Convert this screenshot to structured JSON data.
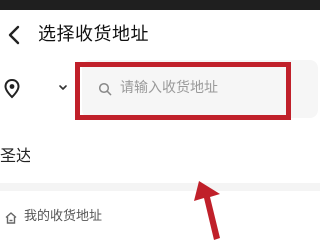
{
  "header": {
    "title": "选择收货地址",
    "back_icon": "chevron-left-icon"
  },
  "location": {
    "pin_icon": "map-pin-icon",
    "caret_icon": "caret-down-icon"
  },
  "search": {
    "icon": "search-icon",
    "placeholder": "请输入收货地址",
    "value": ""
  },
  "city_list": {
    "first_item": "圣达"
  },
  "my_addresses": {
    "icon": "home-icon",
    "label": "我的收货地址"
  },
  "annotation": {
    "color": "#c0202a"
  }
}
